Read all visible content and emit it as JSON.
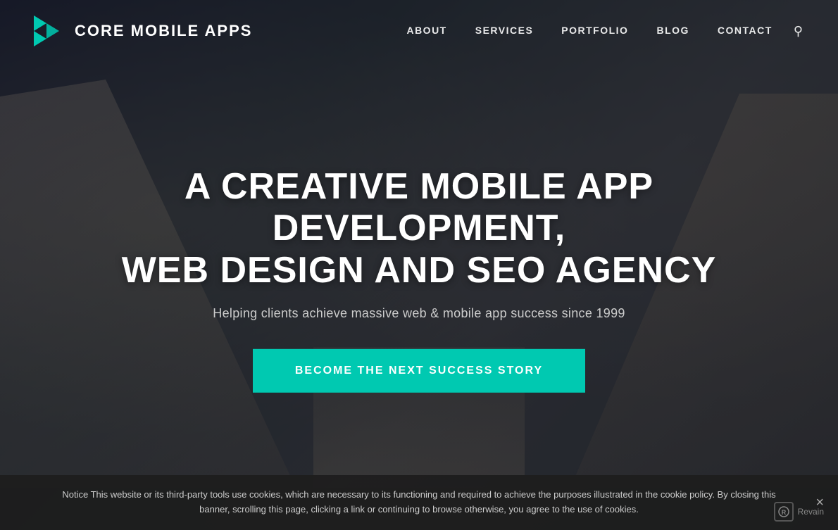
{
  "brand": {
    "name": "CORE MOBILE APPS",
    "logo_alt": "Core Mobile Apps Logo"
  },
  "navbar": {
    "links": [
      {
        "id": "about",
        "label": "ABOUT"
      },
      {
        "id": "services",
        "label": "SERVICES"
      },
      {
        "id": "portfolio",
        "label": "PORTFOLIO"
      },
      {
        "id": "blog",
        "label": "BLOG"
      },
      {
        "id": "contact",
        "label": "CONTACT"
      }
    ]
  },
  "hero": {
    "title_line1": "A CREATIVE MOBILE APP DEVELOPMENT,",
    "title_line2": "WEB DESIGN AND SEO AGENCY",
    "subtitle": "Helping clients achieve massive web & mobile app success since 1999",
    "cta_label": "BECOME THE NEXT SUCCESS STORY"
  },
  "cookie": {
    "text": "Notice This website or its third-party tools use cookies, which are necessary to its functioning and required to achieve the purposes illustrated in the cookie policy. By closing this banner, scrolling this page, clicking a link or continuing to browse otherwise, you agree to the use of cookies.",
    "close_label": "×"
  },
  "revain": {
    "label": "Revain"
  },
  "colors": {
    "teal": "#00c9b1",
    "dark_overlay": "rgba(20,25,35,0.65)",
    "white": "#ffffff"
  }
}
